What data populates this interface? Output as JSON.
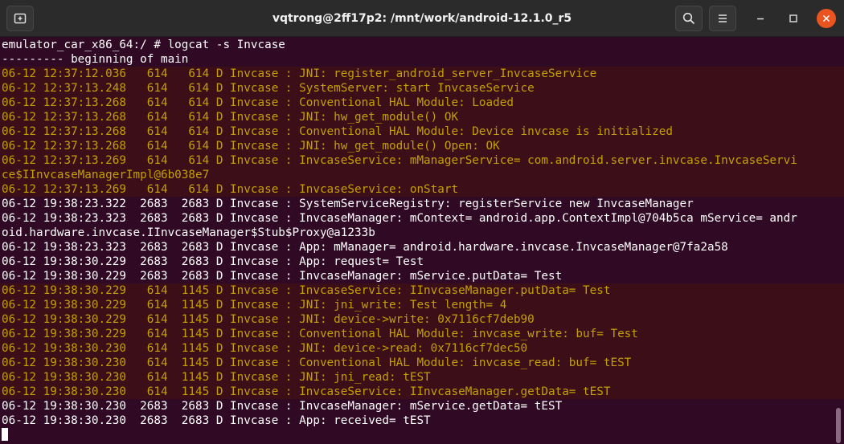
{
  "window": {
    "title": "vqtrong@2ff17p2: /mnt/work/android-12.1.0_r5"
  },
  "header": {
    "new_tab_icon": "new-tab-icon",
    "search_icon": "search-icon",
    "menu_icon": "hamburger-menu-icon",
    "minimize_icon": "minimize-icon",
    "maximize_icon": "maximize-icon",
    "close_icon": "close-icon"
  },
  "colors": {
    "terminal_bg": "#300a24",
    "highlight_bg": "#3b0e18",
    "log_text_pid614": "#c4a000",
    "log_text_default": "#ffffff",
    "close_button": "#e95420"
  },
  "terminal": {
    "lines": [
      {
        "text": "emulator_car_x86_64:/ # logcat -s Invcase",
        "style": "w"
      },
      {
        "text": "--------- beginning of main",
        "style": "w"
      },
      {
        "text": "06-12 12:37:12.036   614   614 D Invcase : JNI: register_android_server_InvcaseService",
        "style": "y"
      },
      {
        "text": "06-12 12:37:13.248   614   614 D Invcase : SystemServer: start InvcaseService",
        "style": "y"
      },
      {
        "text": "06-12 12:37:13.268   614   614 D Invcase : Conventional HAL Module: Loaded",
        "style": "y"
      },
      {
        "text": "06-12 12:37:13.268   614   614 D Invcase : JNI: hw_get_module() OK",
        "style": "y"
      },
      {
        "text": "06-12 12:37:13.268   614   614 D Invcase : Conventional HAL Module: Device invcase is initialized",
        "style": "y"
      },
      {
        "text": "06-12 12:37:13.268   614   614 D Invcase : JNI: hw_get_module() Open: OK",
        "style": "y"
      },
      {
        "text": "06-12 12:37:13.269   614   614 D Invcase : InvcaseService: mManagerService= com.android.server.invcase.InvcaseServi",
        "style": "y"
      },
      {
        "text": "ce$IInvcaseManagerImpl@6b038e7",
        "style": "y"
      },
      {
        "text": "06-12 12:37:13.269   614   614 D Invcase : InvcaseService: onStart",
        "style": "y"
      },
      {
        "text": "06-12 19:38:23.322  2683  2683 D Invcase : SystemServiceRegistry: registerService new InvcaseManager",
        "style": "w"
      },
      {
        "text": "06-12 19:38:23.323  2683  2683 D Invcase : InvcaseManager: mContext= android.app.ContextImpl@704b5ca mService= andr",
        "style": "w"
      },
      {
        "text": "oid.hardware.invcase.IInvcaseManager$Stub$Proxy@a1233b",
        "style": "w"
      },
      {
        "text": "06-12 19:38:23.323  2683  2683 D Invcase : App: mManager= android.hardware.invcase.InvcaseManager@7fa2a58",
        "style": "w"
      },
      {
        "text": "06-12 19:38:30.229  2683  2683 D Invcase : App: request= Test",
        "style": "w"
      },
      {
        "text": "06-12 19:38:30.229  2683  2683 D Invcase : InvcaseManager: mService.putData= Test",
        "style": "w"
      },
      {
        "text": "06-12 19:38:30.229   614  1145 D Invcase : InvcaseService: IInvcaseManager.putData= Test",
        "style": "y"
      },
      {
        "text": "06-12 19:38:30.229   614  1145 D Invcase : JNI: jni_write: Test length= 4",
        "style": "y"
      },
      {
        "text": "06-12 19:38:30.229   614  1145 D Invcase : JNI: device->write: 0x7116cf7deb90",
        "style": "y"
      },
      {
        "text": "06-12 19:38:30.229   614  1145 D Invcase : Conventional HAL Module: invcase_write: buf= Test",
        "style": "y"
      },
      {
        "text": "06-12 19:38:30.230   614  1145 D Invcase : JNI: device->read: 0x7116cf7dec50",
        "style": "y"
      },
      {
        "text": "06-12 19:38:30.230   614  1145 D Invcase : Conventional HAL Module: invcase_read: buf= tEST",
        "style": "y"
      },
      {
        "text": "06-12 19:38:30.230   614  1145 D Invcase : JNI: jni_read: tEST",
        "style": "y"
      },
      {
        "text": "06-12 19:38:30.230   614  1145 D Invcase : InvcaseService: IInvcaseManager.getData= tEST",
        "style": "y"
      },
      {
        "text": "06-12 19:38:30.230  2683  2683 D Invcase : InvcaseManager: mService.getData= tEST",
        "style": "w"
      },
      {
        "text": "06-12 19:38:30.230  2683  2683 D Invcase : App: received= tEST",
        "style": "w"
      }
    ]
  }
}
